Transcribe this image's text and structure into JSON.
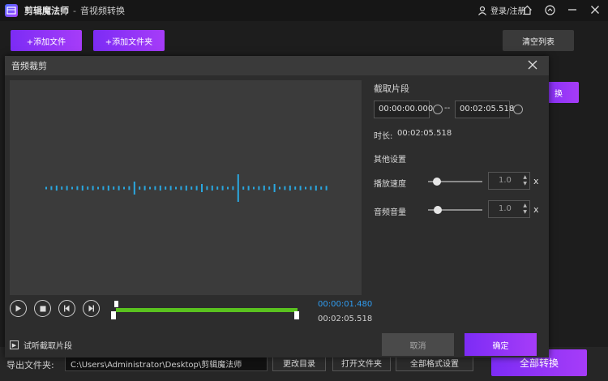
{
  "app": {
    "title": "剪辑魔法师",
    "separator": "-",
    "subtitle": "音视频转换",
    "login": "登录/注册"
  },
  "toolbar": {
    "add_file": "+添加文件",
    "add_folder": "+添加文件夹",
    "clear_list": "清空列表",
    "convert_partial": "换"
  },
  "bottom": {
    "output_label": "导出文件夹:",
    "path": "C:\\Users\\Administrator\\Desktop\\剪辑魔法师",
    "change_dir": "更改目录",
    "open_folder": "打开文件夹",
    "format_settings": "全部格式设置",
    "convert_all": "全部转换"
  },
  "dialog": {
    "title": "音频裁剪",
    "clip_section": "截取片段",
    "start_time": "00:00:00.000",
    "range_sep": "--",
    "end_time": "00:02:05.518",
    "duration_label": "时长:",
    "duration_value": "00:02:05.518",
    "other_settings": "其他设置",
    "speed_label": "播放速度",
    "speed_value": "1.0",
    "speed_unit": "x",
    "volume_label": "音频音量",
    "volume_value": "1.0",
    "volume_unit": "x",
    "current_time": "00:00:01.480",
    "total_time": "00:02:05.518",
    "preview_label": "试听截取片段",
    "cancel": "取消",
    "confirm": "确定"
  },
  "colors": {
    "accent": "#8a2ff6",
    "wave": "#2aa8e0",
    "timeline": "#5ac21f",
    "current_time": "#2f9cf0"
  }
}
